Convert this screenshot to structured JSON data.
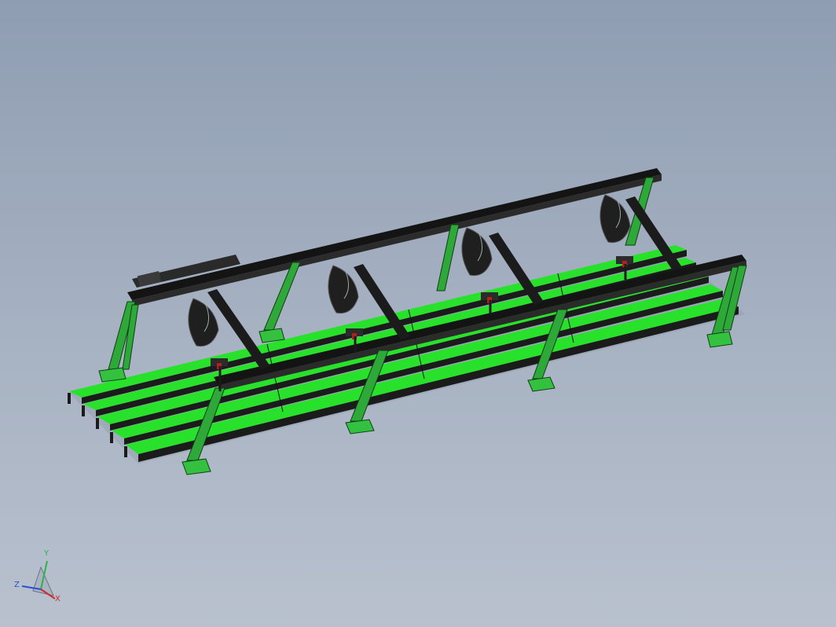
{
  "viewport": {
    "background_top": "#8f9db2",
    "background_bottom": "#b9c1ce"
  },
  "model": {
    "conveyor_color": "#22ee22",
    "frame_color": "#1a1a1a",
    "stand_color": "#2fa83a",
    "accent_color": "#b02020",
    "gantry_spans": 4,
    "conveyor_lanes": 5
  },
  "triad": {
    "x_label": "X",
    "y_label": "Y",
    "z_label": "Z",
    "x_color": "#d22b2b",
    "y_color": "#2bb24b",
    "z_color": "#2b4fd2"
  }
}
